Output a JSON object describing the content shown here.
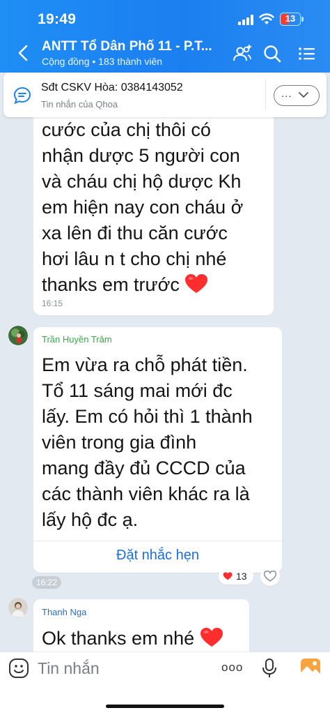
{
  "status_bar": {
    "time": "19:49",
    "battery": "13"
  },
  "header": {
    "title": "ANTT Tổ Dân Phố 11 - P.T...",
    "subtitle": "Cộng đồng • 183 thành viên"
  },
  "pinned": {
    "title": "Sđt CSKV Hòa: 0384143052",
    "subtitle": "Tin nhắn của Qhoa",
    "more_label": "..."
  },
  "messages": [
    {
      "lines": [
        "cước của chị thôi có",
        "nhận dược 5 người con",
        "và cháu chị hộ dược Kh",
        "em hiện nay con cháu ở",
        "xa lên đi thu căn cước",
        "hơi lâu  n t cho chị nhé",
        "thanks em trước"
      ],
      "time": "16:15"
    },
    {
      "sender": "Trần Huyền Trâm",
      "lines": [
        "Em vừa ra chỗ phát tiền.",
        "Tổ 11 sáng mai mới đc",
        "lấy. Em có hỏi thì 1 thành",
        "viên trong gia đình",
        "mang đầy đủ CCCD của",
        "các thành viên khác ra là",
        "lấy hộ đc ạ."
      ],
      "reminder": "Đặt nhắc hẹn",
      "time": "16:22",
      "reaction_count": "13"
    },
    {
      "sender": "Thanh Nga",
      "text": "Ok thanks em nhé"
    }
  ],
  "composer": {
    "placeholder": "Tin nhắn",
    "more_label": "ooo"
  },
  "colors": {
    "header_blue": "#1b7ff0",
    "chat_background": "#e2e9f1",
    "link_blue": "#1a6fe0",
    "sender_green": "#3aa84a",
    "sender_blue": "#2a6fc0",
    "heart_red": "#ff2d2d"
  },
  "icons": {
    "back": "chevron-left-icon",
    "members": "add-member-icon",
    "search": "search-icon",
    "menu": "list-menu-icon",
    "pin": "chat-bubble-icon",
    "sticker": "emoji-icon",
    "mic": "microphone-icon",
    "photo": "image-icon"
  }
}
